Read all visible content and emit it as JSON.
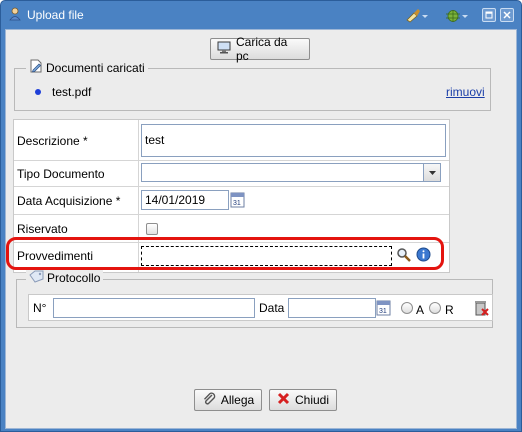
{
  "window": {
    "title": "Upload file"
  },
  "toolbar": {
    "upload_button": "Carica da pc"
  },
  "uploaded": {
    "legend": "Documenti caricati",
    "files": [
      {
        "name": "test.pdf",
        "remove_label": "rimuovi"
      }
    ]
  },
  "form": {
    "descrizione": {
      "label": "Descrizione *",
      "value": "test"
    },
    "tipo_documento": {
      "label": "Tipo Documento",
      "value": ""
    },
    "data_acquisizione": {
      "label": "Data Acquisizione *",
      "value": "14/01/2019"
    },
    "riservato": {
      "label": "Riservato",
      "checked": false
    },
    "provvedimenti": {
      "label": "Provvedimenti",
      "value": ""
    }
  },
  "protocollo": {
    "legend": "Protocollo",
    "number_label": "N°",
    "number_value": "",
    "date_label": "Data",
    "date_value": "",
    "radio_a": "A",
    "radio_r": "R"
  },
  "footer": {
    "allega_label": "Allega",
    "chiudi_label": "Chiudi"
  },
  "colors": {
    "title_bg": "#4a82c3",
    "highlight": "#e4140f",
    "link": "#1a3ea8"
  }
}
